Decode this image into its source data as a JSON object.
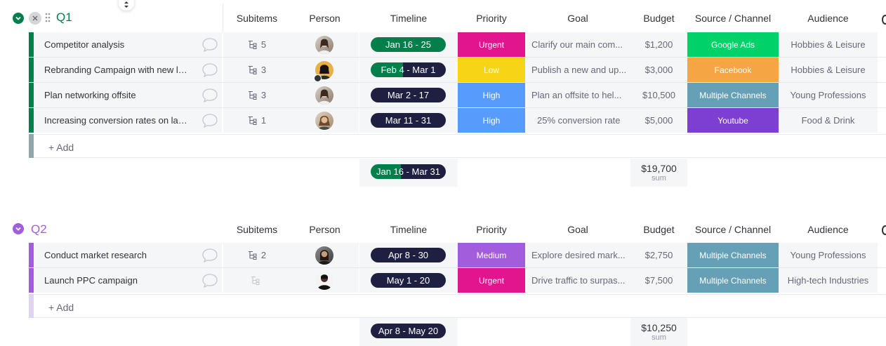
{
  "columns": {
    "subitems": "Subitems",
    "person": "Person",
    "timeline": "Timeline",
    "priority": "Priority",
    "goal": "Goal",
    "budget": "Budget",
    "source": "Source / Channel",
    "audience": "Audience"
  },
  "colors": {
    "q1_group": "#037f4c",
    "q2_group": "#a25ddc",
    "timeline_dark": "#1f2041",
    "timeline_green": "#037f4c",
    "urgent": "#e2158f",
    "low": "#f8d416",
    "high": "#579bfc",
    "medium": "#a25ddc",
    "google_ads": "#00d26a",
    "facebook": "#f6a544",
    "multiple_channels": "#66a0b6",
    "youtube": "#7d3fd2"
  },
  "groups": [
    {
      "title": "Q1",
      "add_label": "+ Add",
      "summary": {
        "timeline": "Jan 16 - Mar 31",
        "budget": "$19,700",
        "budget_label": "sum"
      },
      "rows": [
        {
          "name": "Competitor analysis",
          "subitems": "5",
          "timeline": "Jan 16 - 25",
          "priority": "Urgent",
          "goal": "Clarify our main com...",
          "budget": "$1,200",
          "source": "Google Ads",
          "audience": "Hobbies & Leisure"
        },
        {
          "name": "Rebranding Campaign with new lo...",
          "subitems": "3",
          "timeline": "Feb 4 - Mar 1",
          "priority": "Low",
          "goal": "Publish a new and up...",
          "budget": "$3,000",
          "source": "Facebook",
          "audience": "Hobbies & Leisure"
        },
        {
          "name": "Plan networking offsite",
          "subitems": "3",
          "timeline": "Mar 2 - 17",
          "priority": "High",
          "goal": "Plan an offsite to hel...",
          "budget": "$10,500",
          "source": "Multiple Channels",
          "audience": "Young Professions"
        },
        {
          "name": "Increasing conversion rates on lan...",
          "subitems": "1",
          "timeline": "Mar 11 - 31",
          "priority": "High",
          "goal": "25% conversion rate",
          "budget": "$5,000",
          "source": "Youtube",
          "audience": "Food & Drink"
        }
      ]
    },
    {
      "title": "Q2",
      "add_label": "+ Add",
      "summary": {
        "timeline": "Apr 8 - May 20",
        "budget": "$10,250",
        "budget_label": "sum"
      },
      "rows": [
        {
          "name": "Conduct market research",
          "subitems": "2",
          "timeline": "Apr 8 - 30",
          "priority": "Medium",
          "goal": "Explore desired mark...",
          "budget": "$2,750",
          "source": "Multiple Channels",
          "audience": "Young Professions"
        },
        {
          "name": "Launch PPC campaign",
          "subitems": "",
          "timeline": "May 1 - 20",
          "priority": "Urgent",
          "goal": "Drive traffic to surpas...",
          "budget": "$7,500",
          "source": "Multiple Channels",
          "audience": "High-tech Industries"
        }
      ]
    }
  ]
}
